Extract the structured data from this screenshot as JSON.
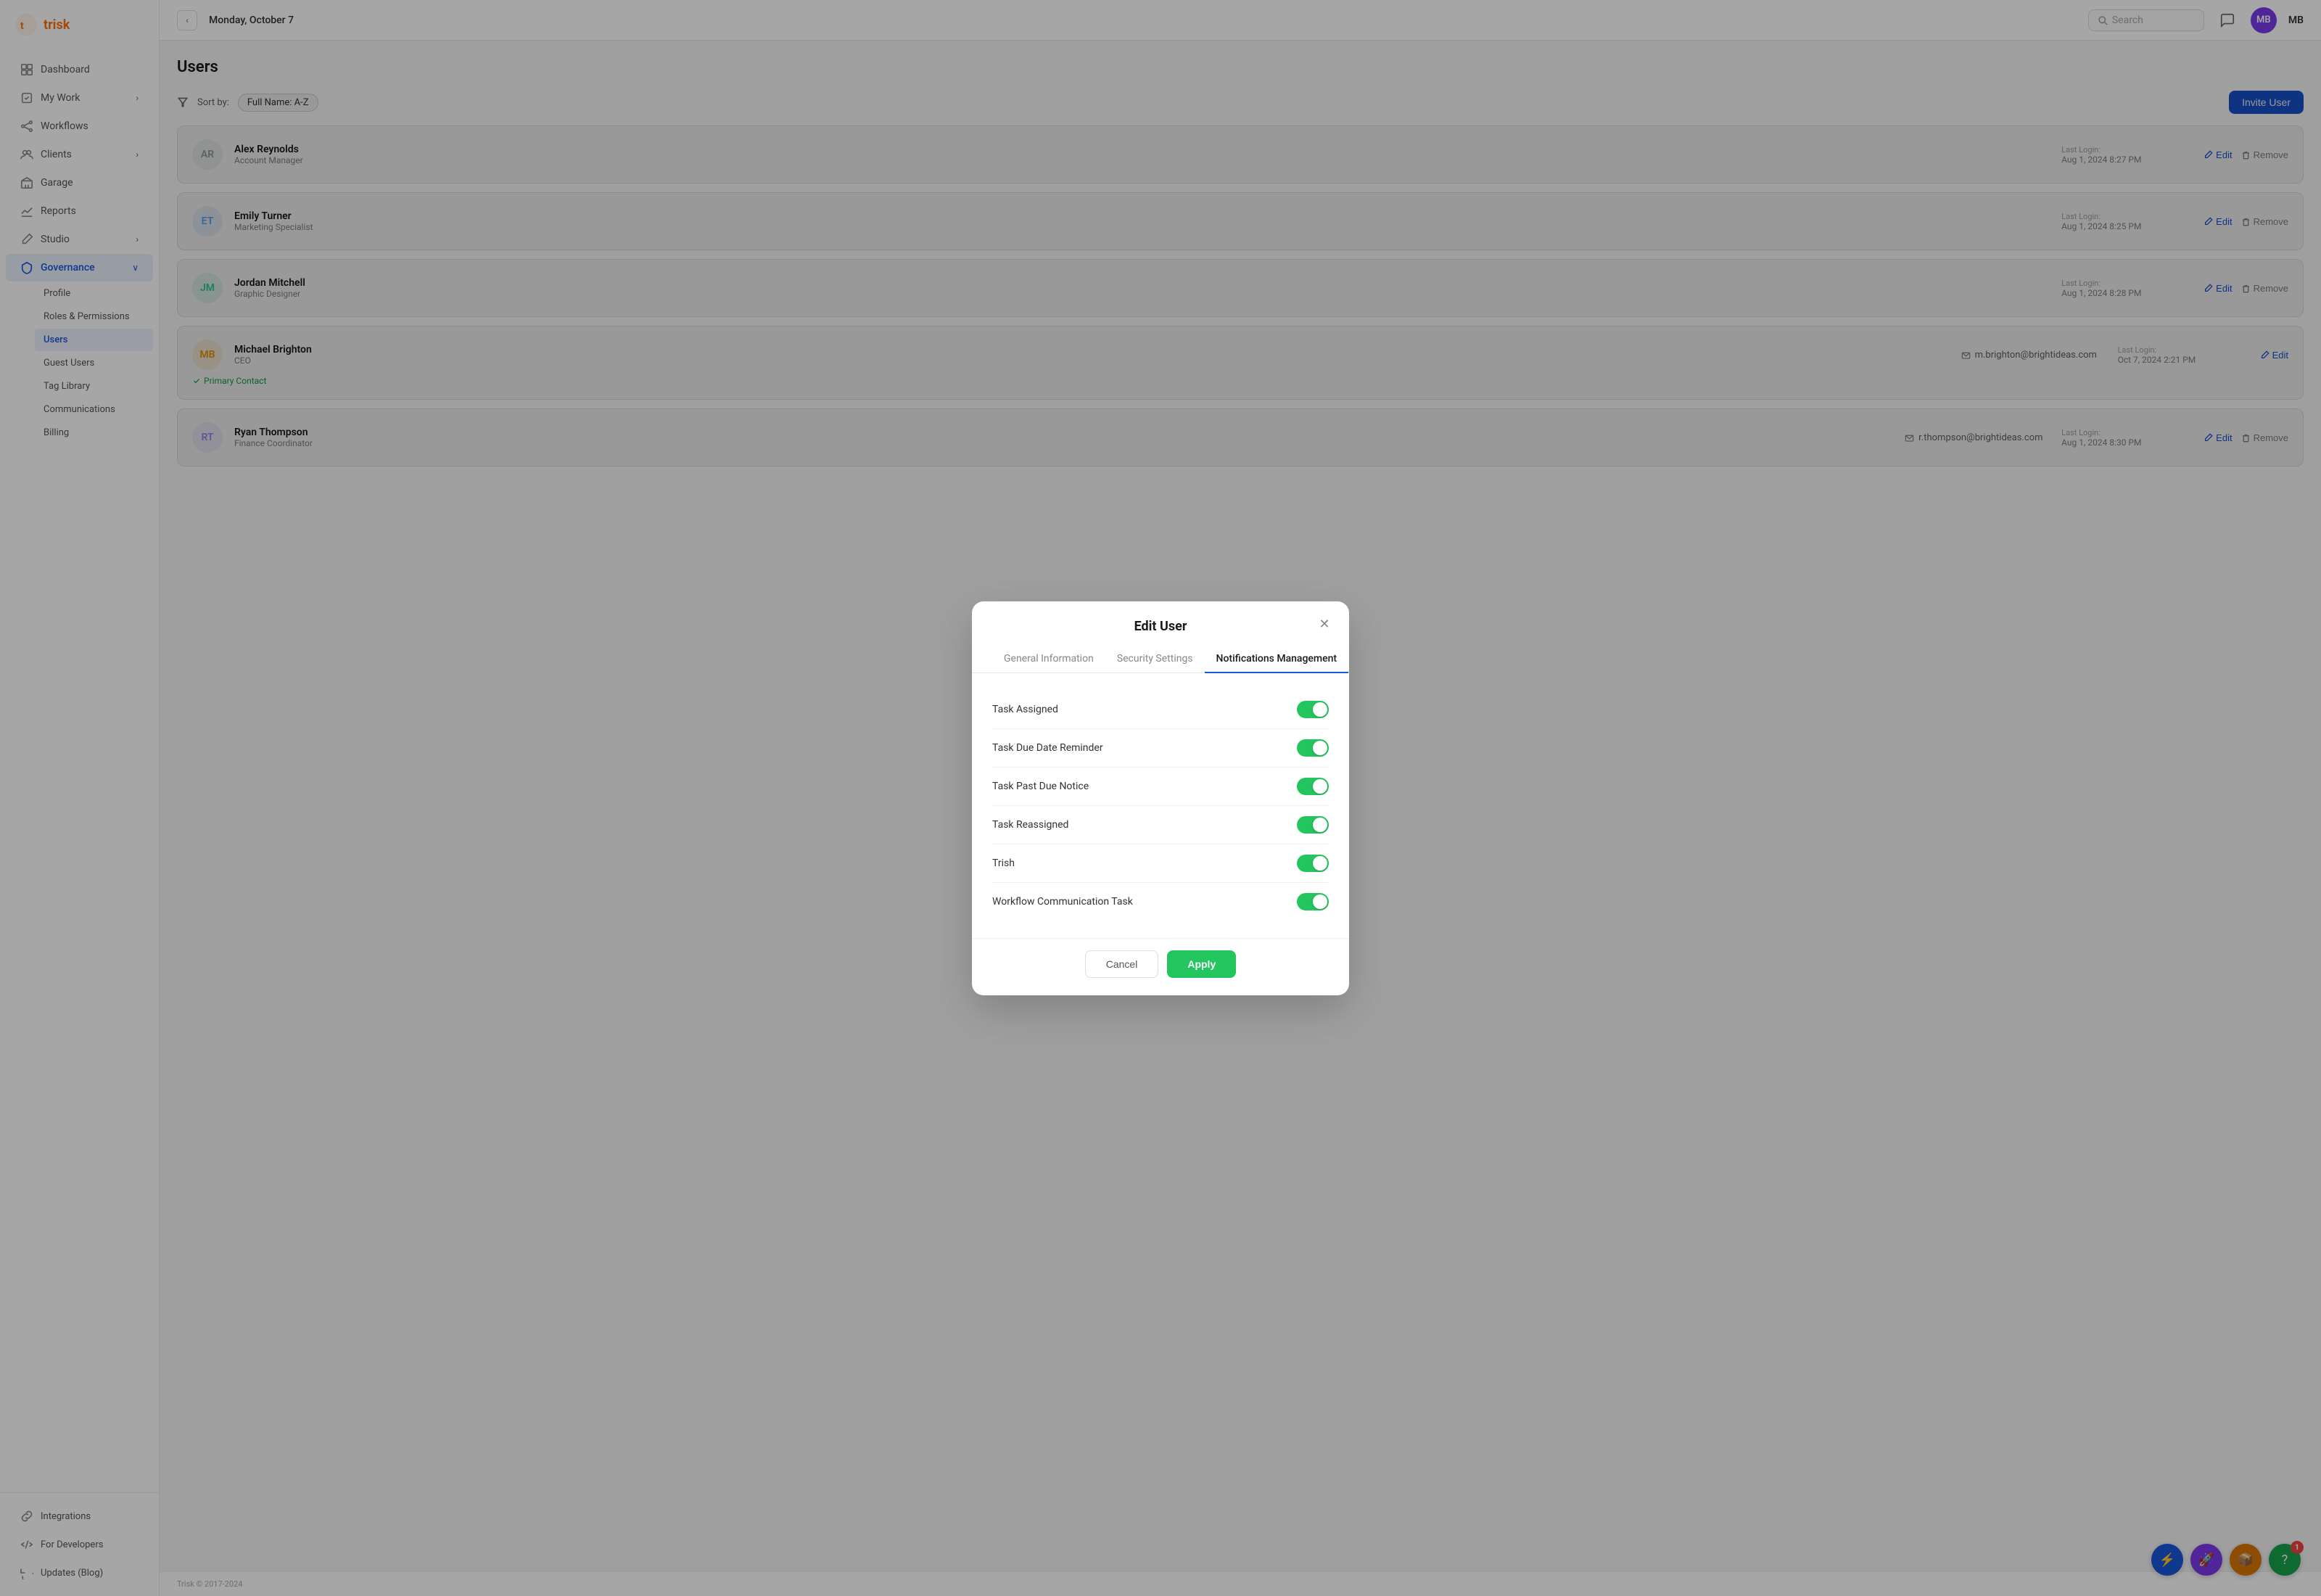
{
  "brand": {
    "name": "trisk",
    "logo_color": "#f97316"
  },
  "topbar": {
    "back_label": "‹",
    "date": "Monday, October 7",
    "search_placeholder": "Search",
    "avatar_initials": "MB",
    "avatar_color": "#7c3aed"
  },
  "sidebar": {
    "nav_items": [
      {
        "id": "dashboard",
        "label": "Dashboard",
        "icon": "grid"
      },
      {
        "id": "my-work",
        "label": "My Work",
        "icon": "check-square",
        "has_chevron": true
      },
      {
        "id": "workflows",
        "label": "Workflows",
        "icon": "git-branch"
      },
      {
        "id": "clients",
        "label": "Clients",
        "icon": "users",
        "has_chevron": true
      },
      {
        "id": "garage",
        "label": "Garage",
        "icon": "briefcase"
      },
      {
        "id": "reports",
        "label": "Reports",
        "icon": "bar-chart"
      },
      {
        "id": "studio",
        "label": "Studio",
        "icon": "edit",
        "has_chevron": true
      },
      {
        "id": "governance",
        "label": "Governance",
        "icon": "shield",
        "active": true,
        "has_chevron": true
      }
    ],
    "governance_sub": [
      {
        "id": "profile",
        "label": "Profile"
      },
      {
        "id": "roles-permissions",
        "label": "Roles & Permissions"
      },
      {
        "id": "users",
        "label": "Users",
        "active": true
      },
      {
        "id": "guest-users",
        "label": "Guest Users"
      },
      {
        "id": "tag-library",
        "label": "Tag Library"
      },
      {
        "id": "communications",
        "label": "Communications"
      },
      {
        "id": "billing",
        "label": "Billing"
      }
    ],
    "footer_items": [
      {
        "id": "integrations",
        "label": "Integrations",
        "icon": "link"
      },
      {
        "id": "for-developers",
        "label": "For Developers",
        "icon": "code"
      },
      {
        "id": "updates-blog",
        "label": "Updates (Blog)",
        "icon": "refresh"
      }
    ]
  },
  "page": {
    "title": "Users",
    "toolbar": {
      "sort_label": "Sort by:",
      "sort_value": "Full Name: A-Z",
      "invite_button": "Invite User"
    }
  },
  "users": [
    {
      "initials": "AR",
      "name": "Alex Reynolds",
      "role": "Account Manager",
      "email": "",
      "last_login_label": "Last Login:",
      "last_login": "Aug 1, 2024 8:27 PM",
      "primary_contact": false
    },
    {
      "initials": "ET",
      "name": "Emily Turner",
      "role": "Marketing Specialist",
      "email": "",
      "last_login_label": "Last Login:",
      "last_login": "Aug 1, 2024 8:25 PM",
      "primary_contact": false
    },
    {
      "initials": "JM",
      "name": "Jordan Mitchell",
      "role": "Graphic Designer",
      "email": "",
      "last_login_label": "Last Login:",
      "last_login": "Aug 1, 2024 8:28 PM",
      "primary_contact": false
    },
    {
      "initials": "MB",
      "name": "Michael Brighton",
      "role": "CEO",
      "email": "m.brighton@brightideas.com",
      "last_login_label": "Last Login:",
      "last_login": "Oct 7, 2024 2:21 PM",
      "primary_contact": true,
      "primary_contact_label": "Primary Contact"
    },
    {
      "initials": "RT",
      "name": "Ryan Thompson",
      "role": "Finance Coordinator",
      "email": "r.thompson@brightideas.com",
      "last_login_label": "Last Login:",
      "last_login": "Aug 1, 2024 8:30 PM",
      "primary_contact": false
    }
  ],
  "footer": {
    "copyright": "Trisk © 2017-2024"
  },
  "modal": {
    "title": "Edit User",
    "tabs": [
      {
        "id": "general",
        "label": "General Information"
      },
      {
        "id": "security",
        "label": "Security Settings"
      },
      {
        "id": "notifications",
        "label": "Notifications Management",
        "active": true
      }
    ],
    "notifications": [
      {
        "id": "task-assigned",
        "label": "Task Assigned",
        "enabled": true
      },
      {
        "id": "task-due-date",
        "label": "Task Due Date Reminder",
        "enabled": true
      },
      {
        "id": "task-past-due",
        "label": "Task Past Due Notice",
        "enabled": true
      },
      {
        "id": "task-reassigned",
        "label": "Task Reassigned",
        "enabled": true
      },
      {
        "id": "trish",
        "label": "Trish",
        "enabled": true
      },
      {
        "id": "workflow-communication",
        "label": "Workflow Communication Task",
        "enabled": true
      }
    ],
    "cancel_label": "Cancel",
    "apply_label": "Apply"
  },
  "fabs": [
    {
      "id": "bolt",
      "color": "#1a56db",
      "symbol": "⚡"
    },
    {
      "id": "rocket",
      "color": "#7c3aed",
      "symbol": "🚀"
    },
    {
      "id": "box",
      "color": "#d97706",
      "symbol": "📦"
    },
    {
      "id": "help",
      "color": "#16a34a",
      "symbol": "?",
      "badge": "1"
    }
  ]
}
